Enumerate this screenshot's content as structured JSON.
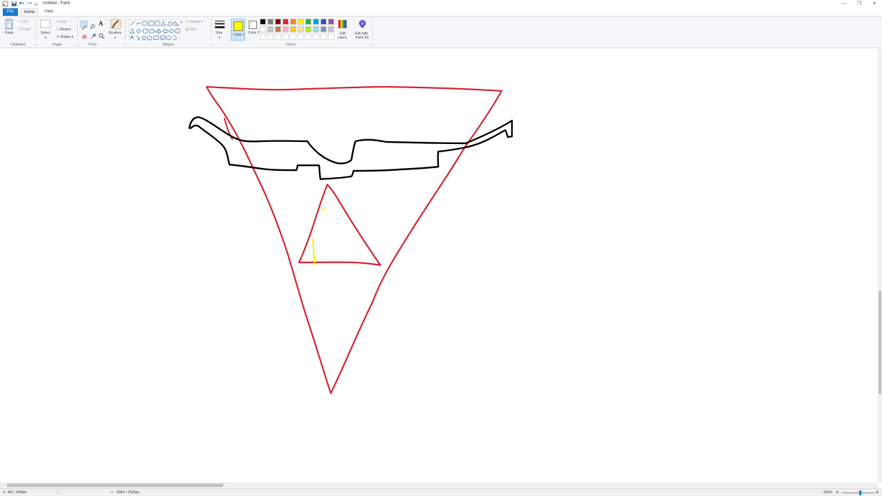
{
  "window": {
    "title": "Untitled - Paint",
    "minimize_glyph": "—",
    "restore_glyph": "❐",
    "close_glyph": "✕"
  },
  "tabs": [
    {
      "label": "File"
    },
    {
      "label": "Home"
    },
    {
      "label": "View"
    }
  ],
  "ribbon": {
    "clipboard": {
      "label": "Clipboard",
      "paste": "Paste",
      "cut": "Cut",
      "copy": "Copy"
    },
    "image": {
      "label": "Image",
      "select": "Select",
      "crop": "Crop",
      "resize": "Resize",
      "rotate": "Rotate ▾"
    },
    "tools": {
      "label": "Tools",
      "text_glyph": "A"
    },
    "brushes": {
      "label": "Brushes"
    },
    "shapes": {
      "label": "Shapes",
      "outline": "Outline ▾",
      "fill": "Fill ▾"
    },
    "size": {
      "label": "Size"
    },
    "colors": {
      "label": "Colors",
      "color1": "Color 1",
      "color2": "Color 2",
      "edit_colors": "Edit with colors",
      "edit_colors_line1": "Edit",
      "edit_colors_line2": "colors",
      "paint3d_line1": "Edit with",
      "paint3d_line2": "Paint 3D",
      "color1_value": "#ffff00",
      "color2_value": "#ffffff",
      "palette_row1": [
        "#000000",
        "#7f7f7f",
        "#880015",
        "#ed1c24",
        "#ff7f27",
        "#fff200",
        "#22b14c",
        "#00a2e8",
        "#3f48cc",
        "#a349a4"
      ],
      "palette_row2": [
        "#ffffff",
        "#c3c3c3",
        "#b97a57",
        "#ffaec9",
        "#ffc90e",
        "#efe4b0",
        "#b5e61d",
        "#99d9ea",
        "#7092be",
        "#c8bfe7"
      ]
    }
  },
  "status": {
    "cursor_position": "462, 1645px",
    "canvas_size": "5064 × 2516px",
    "zoom": "200%"
  },
  "drawing": {
    "stroke_colors": {
      "red": "#d7202f",
      "black": "#000000",
      "yellow": "#ffee00"
    }
  }
}
